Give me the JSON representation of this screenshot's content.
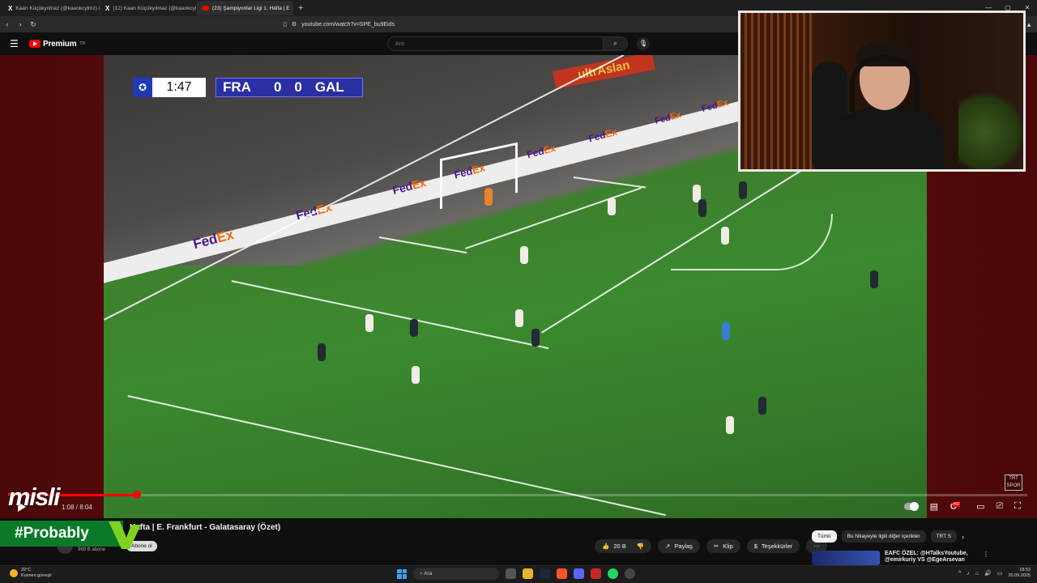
{
  "browser": {
    "tabs": [
      {
        "label": "Kaan Küçükyılmaz (@kaankcylmz) /",
        "type": "x"
      },
      {
        "label": "(12) Kaan Küçükyılmaz (@kaankcyl",
        "type": "x"
      },
      {
        "label": "(23) Şampiyonlar Ligi 1. Hafta | E",
        "type": "yt"
      }
    ],
    "url": "youtube.com/watch?v=SPE_bu9Eids"
  },
  "youtube": {
    "brand": "Premium",
    "region": "TR",
    "search_placeholder": "Ara"
  },
  "video": {
    "scoreboard": {
      "clock": "1:47",
      "home": "FRA",
      "home_score": "0",
      "away_score": "0",
      "away": "GAL"
    },
    "board_text": "FedEx",
    "stand_banner": "ultrAslan",
    "broadcaster": "TRT SPOR",
    "progress_fraction": 0.125,
    "timecode": "1:08 / 8:04"
  },
  "overlay": {
    "misli": "misli",
    "probably": "#Probably"
  },
  "below": {
    "title": "Hafta | E. Frankfurt - Galatasaray (Özet)",
    "subscribers": "969 B abone",
    "subscribe_label": "Abone ol",
    "likes": "20 B",
    "share": "Paylaş",
    "clip": "Klip",
    "thanks": "Teşekkürler",
    "chips": [
      "Tümü",
      "Bu hikayeyle ilgili diğer içerikler",
      "TRT S"
    ],
    "rec_title": "EAFC ÖZEL: @HTalksYoutube, @emirkuriy VS @EgeArsevan"
  },
  "taskbar": {
    "temp": "22°C",
    "weather": "Kısmen güneşli",
    "search": "Ara",
    "time": "18:53",
    "date": "20.09.2025"
  },
  "colors": {
    "accent": "#ff0000",
    "probably_green": "#0a7a28",
    "score_blue": "#2a2fa3"
  }
}
